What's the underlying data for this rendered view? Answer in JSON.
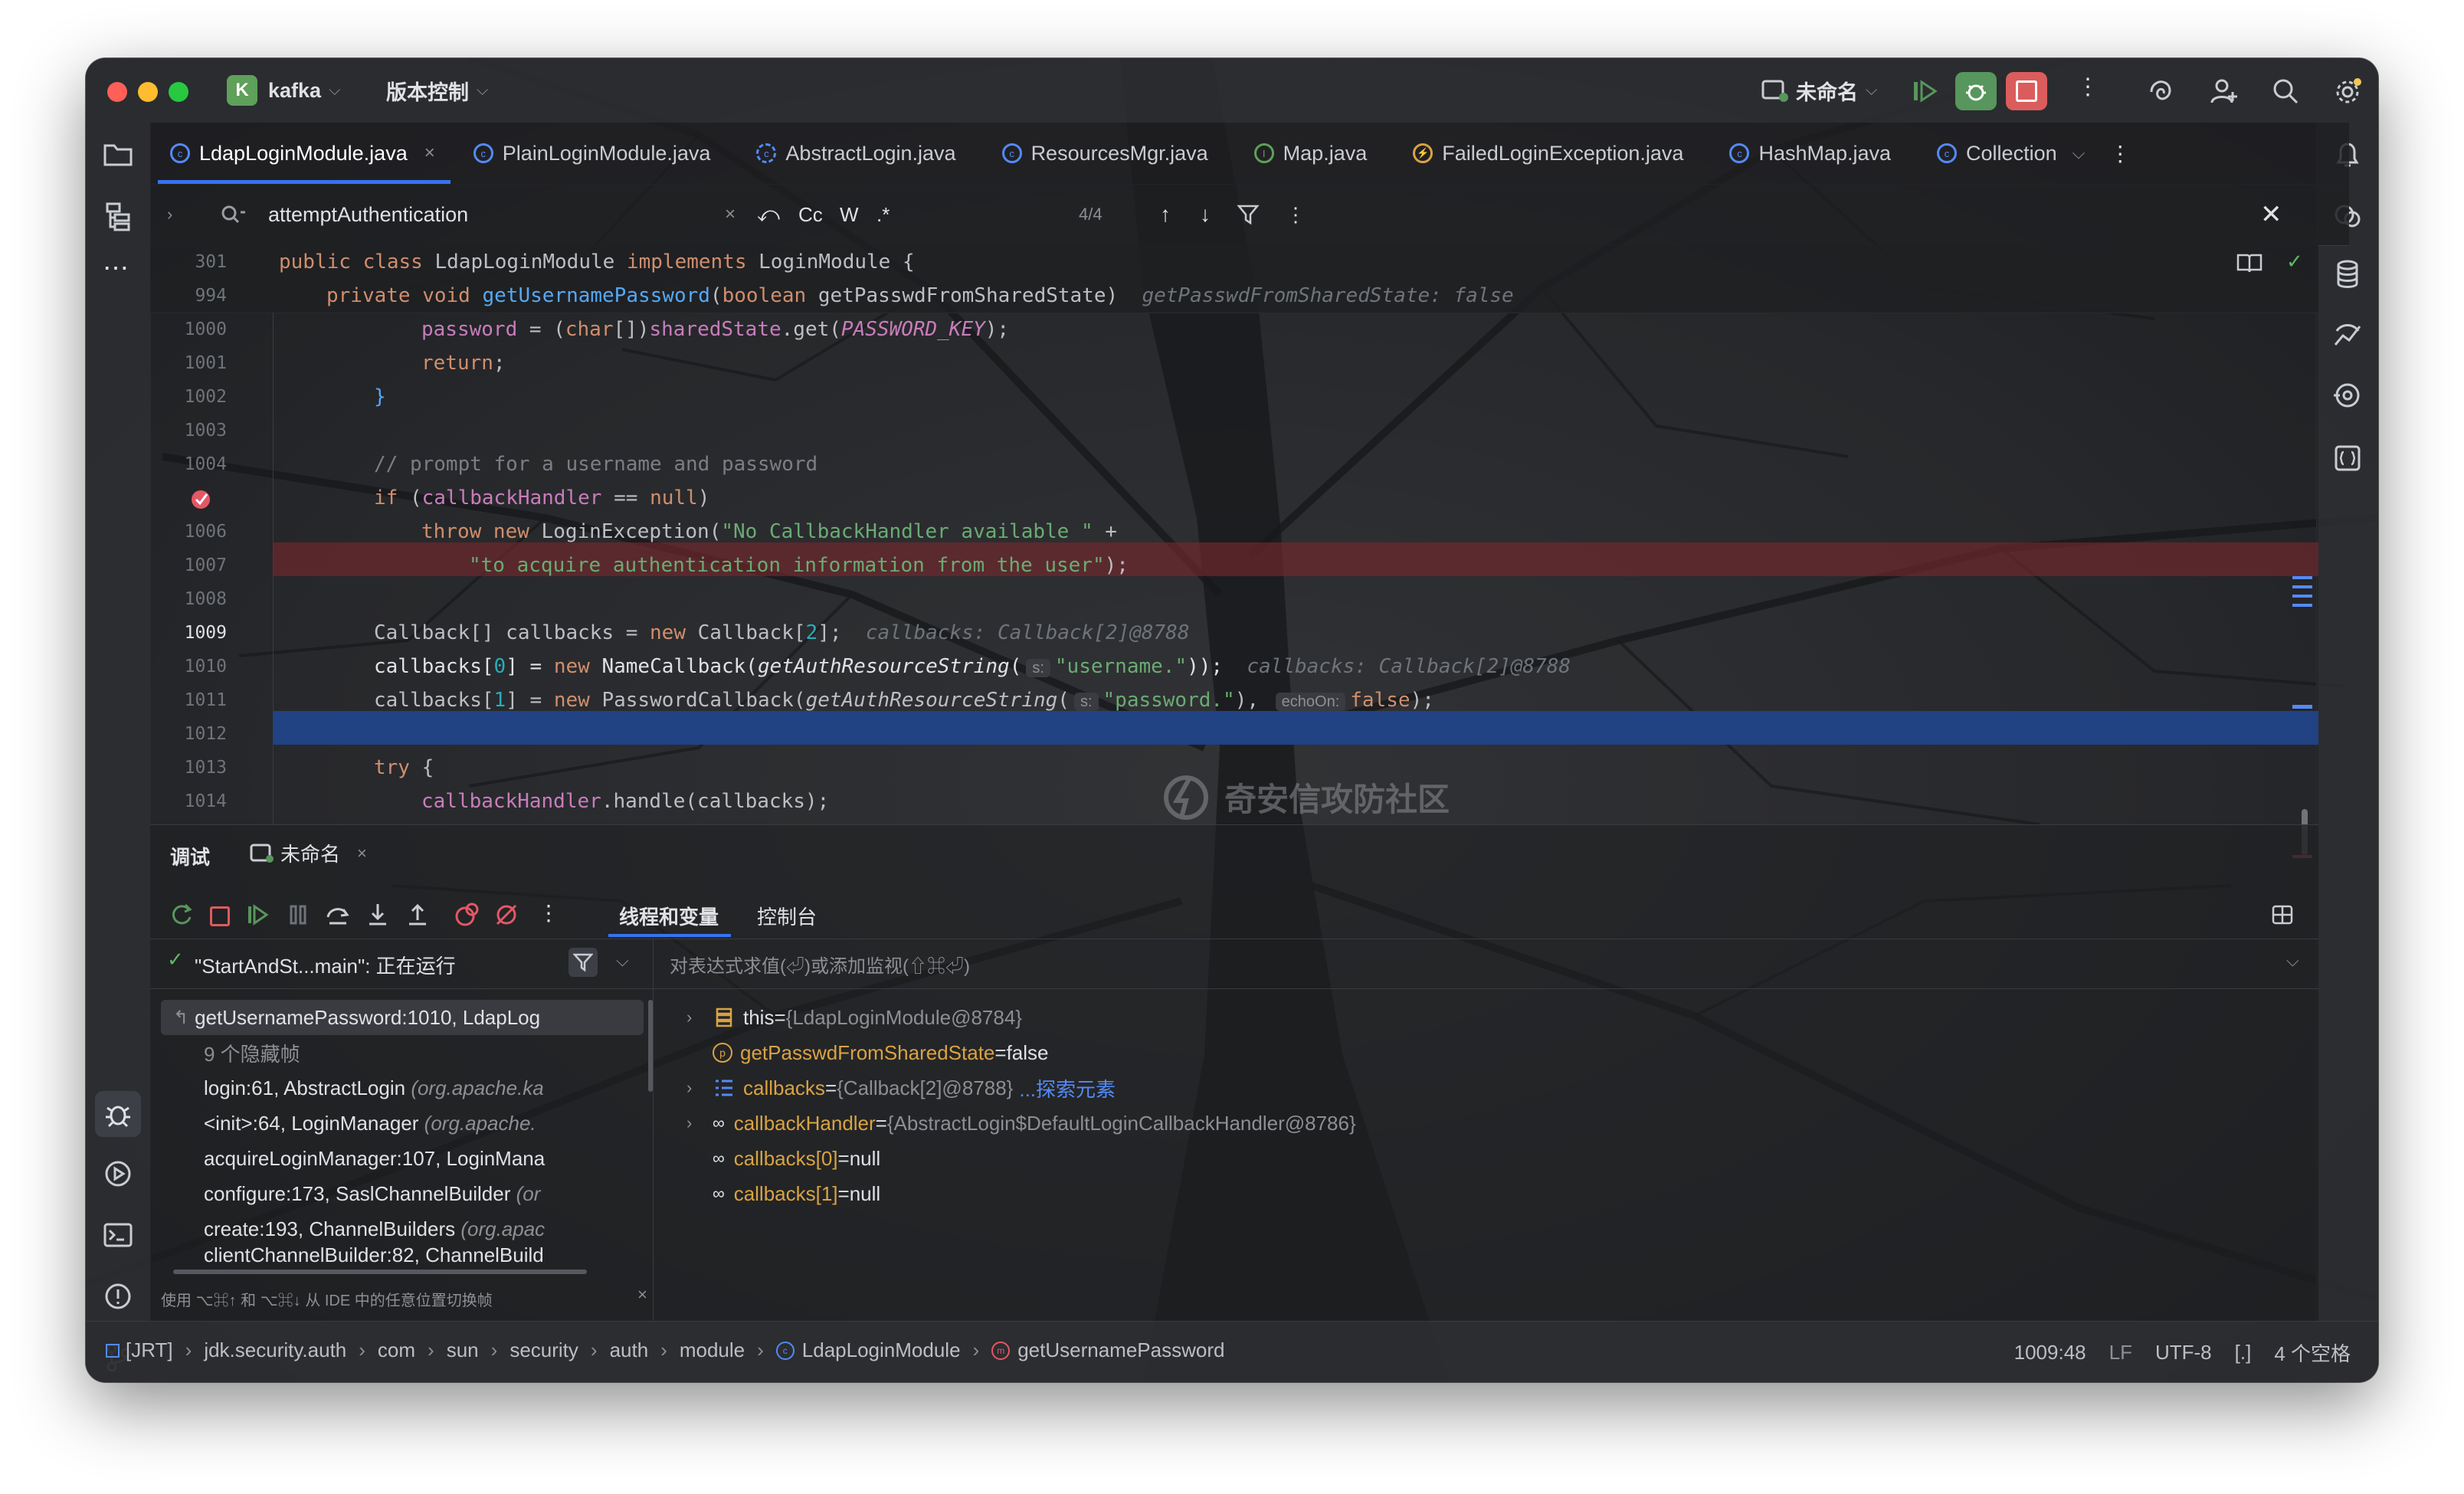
{
  "titlebar": {
    "project_initial": "K",
    "project_name": "kafka",
    "vcs_label": "版本控制",
    "run_config": "未命名"
  },
  "tabs": [
    {
      "label": "LdapLoginModule.java",
      "active": true
    },
    {
      "label": "PlainLoginModule.java"
    },
    {
      "label": "AbstractLogin.java"
    },
    {
      "label": "ResourcesMgr.java"
    },
    {
      "label": "Map.java"
    },
    {
      "label": "FailedLoginException.java"
    },
    {
      "label": "HashMap.java"
    },
    {
      "label": "Collection"
    }
  ],
  "find": {
    "query": "attemptAuthentication",
    "case_label": "Cc",
    "word_label": "W",
    "regex_label": ".*",
    "count": "4/4"
  },
  "editor": {
    "sticky1_ln": "301",
    "sticky1_code": "public class LdapLoginModule implements LoginModule {",
    "sticky2_ln": "994",
    "sticky2_code": "private void getUsernamePassword(boolean getPasswdFromSharedState)",
    "sticky2_hint": "getPasswdFromSharedState: false",
    "lines": {
      "l1000": "1000",
      "l1001": "1001",
      "l1002": "1002",
      "l1003": "1003",
      "l1004": "1004",
      "l1006": "1006",
      "l1007": "1007",
      "l1008": "1008",
      "l1009": "1009",
      "l1010": "1010",
      "l1011": "1011",
      "l1012": "1012",
      "l1013": "1013",
      "l1014": "1014"
    },
    "hint_1009": "callbacks: Callback[2]@8788",
    "hint_1010": "callbacks: Callback[2]@8788",
    "param_s": "s:",
    "param_echo": "echoOn:"
  },
  "debug": {
    "tab_debug": "调试",
    "tab_config": "未命名",
    "subtab_threads": "线程和变量",
    "subtab_console": "控制台",
    "thread": "\"StartAndSt...main\": 正在运行",
    "eval_placeholder": "对表达式求值(⏎)或添加监视(⇧⌘⏎)",
    "frames": [
      {
        "method": "getUsernamePassword:1010, LdapLog",
        "pkg": ""
      },
      {
        "method": "9 个隐藏帧",
        "pkg": ""
      },
      {
        "method": "login:61, AbstractLogin",
        "pkg": "(org.apache.ka"
      },
      {
        "method": "<init>:64, LoginManager",
        "pkg": "(org.apache."
      },
      {
        "method": "acquireLoginManager:107, LoginMana",
        "pkg": ""
      },
      {
        "method": "configure:173, SaslChannelBuilder",
        "pkg": "(or"
      },
      {
        "method": "create:193, ChannelBuilders",
        "pkg": "(org.apac"
      },
      {
        "method": "clientChannelBuilder:82, ChannelBuild",
        "pkg": ""
      }
    ],
    "frames_hint": "使用 ⌥⌘↑ 和 ⌥⌘↓ 从 IDE 中的任意位置切换帧",
    "vars": [
      {
        "name": "this",
        "eq": " = ",
        "value": "{LdapLoginModule@8784}"
      },
      {
        "name": "getPasswdFromSharedState",
        "eq": " = ",
        "value": "false"
      },
      {
        "name": "callbacks",
        "eq": " = ",
        "value": "{Callback[2]@8788}",
        "link": "...探索元素"
      },
      {
        "name": "callbackHandler",
        "eq": " = ",
        "value": "{AbstractLogin$DefaultLoginCallbackHandler@8786}"
      },
      {
        "name": "callbacks[0]",
        "eq": " = ",
        "value": "null"
      },
      {
        "name": "callbacks[1]",
        "eq": " = ",
        "value": "null"
      }
    ]
  },
  "statusbar": {
    "crumbs": [
      "[JRT]",
      "jdk.security.auth",
      "com",
      "sun",
      "security",
      "auth",
      "module",
      "LdapLoginModule",
      "getUsernamePassword"
    ],
    "position": "1009:48",
    "line_sep": "LF",
    "encoding": "UTF-8",
    "indent_icon": "[.]",
    "indent": "4 个空格"
  },
  "watermark": "奇安信攻防社区",
  "colors": {
    "accent": "#3574f0",
    "breakpoint": "#e55765",
    "run_green": "#57965c",
    "stop_red": "#db5c5c"
  }
}
